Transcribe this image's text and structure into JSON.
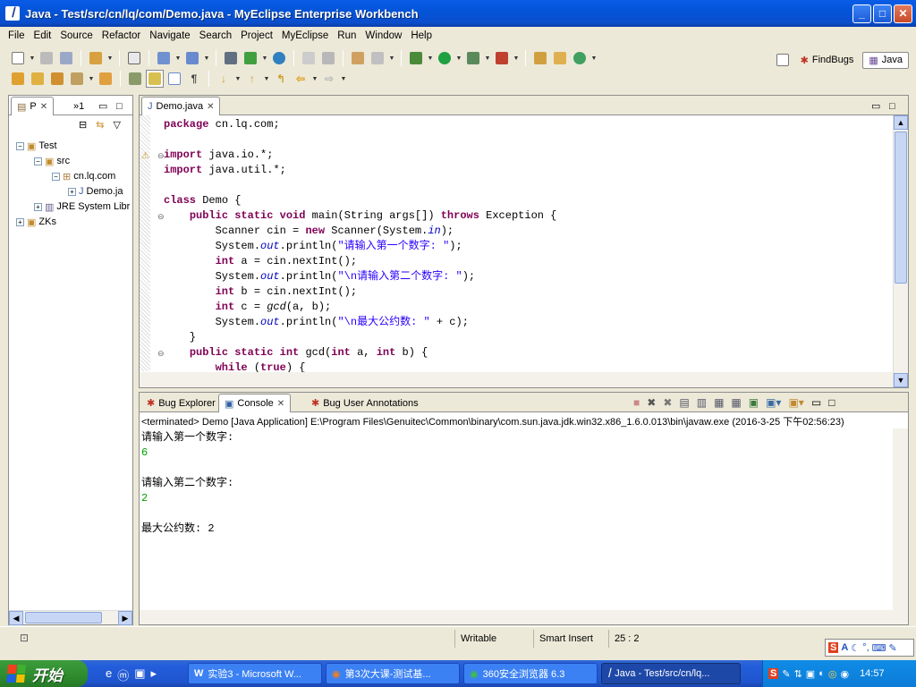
{
  "window": {
    "title": "Java - Test/src/cn/lq/com/Demo.java - MyEclipse Enterprise Workbench"
  },
  "menu": [
    "File",
    "Edit",
    "Source",
    "Refactor",
    "Navigate",
    "Search",
    "Project",
    "MyEclipse",
    "Run",
    "Window",
    "Help"
  ],
  "perspectives": {
    "findbugs": "FindBugs",
    "java": "Java"
  },
  "explorer": {
    "tab1": "P",
    "tab2": "»1",
    "tree": {
      "project": "Test",
      "src": "src",
      "package": "cn.lq.com",
      "file": "Demo.ja",
      "jre": "JRE System Libr",
      "zks": "ZKs"
    }
  },
  "editor": {
    "tab": "Demo.java",
    "code": [
      "package cn.lq.com;",
      "",
      "import java.io.*;",
      "import java.util.*;",
      "",
      "class Demo {",
      "    public static void main(String args[]) throws Exception {",
      "        Scanner cin = new Scanner(System.in);",
      "        System.out.println(\"请输入第一个数字: \");",
      "        int a = cin.nextInt();",
      "        System.out.println(\"\\n请输入第二个数字: \");",
      "        int b = cin.nextInt();",
      "        int c = gcd(a, b);",
      "        System.out.println(\"\\n最大公约数: \" + c);",
      "    }",
      "    public static int gcd(int a, int b) {",
      "        while (true) {"
    ]
  },
  "console_panel": {
    "tabs": [
      "Bug Explorer",
      "Console",
      "Bug User Annotations"
    ],
    "header": "<terminated> Demo [Java Application] E:\\Program Files\\Genuitec\\Common\\binary\\com.sun.java.jdk.win32.x86_1.6.0.013\\bin\\javaw.exe (2016-3-25 下午02:56:23)",
    "lines": [
      {
        "text": "请输入第一个数字:",
        "input": false
      },
      {
        "text": "6",
        "input": true
      },
      {
        "text": "",
        "input": false
      },
      {
        "text": "请输入第二个数字:",
        "input": false
      },
      {
        "text": "2",
        "input": true
      },
      {
        "text": "",
        "input": false
      },
      {
        "text": "最大公约数: 2",
        "input": false
      }
    ]
  },
  "status": {
    "writable": "Writable",
    "insert_mode": "Smart Insert",
    "position": "25 : 2"
  },
  "taskbar": {
    "start": "开始",
    "items": [
      "实验3 - Microsoft W...",
      "第3次大课-测试基...",
      "360安全浏览器 6.3",
      "Java - Test/src/cn/lq..."
    ],
    "clock": "14:57"
  }
}
